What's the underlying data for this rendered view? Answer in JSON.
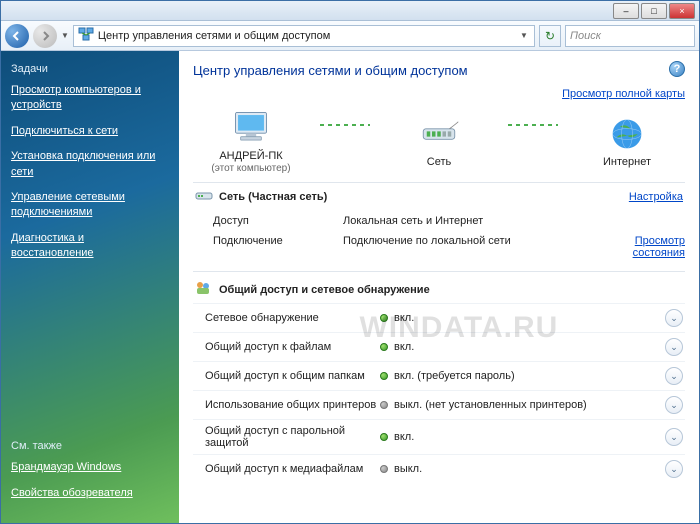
{
  "titlebar": {
    "min": "–",
    "max": "□",
    "close": "×"
  },
  "address_bar": {
    "text": "Центр управления сетями и общим доступом",
    "dropdown": "▼",
    "refresh": "↻"
  },
  "search": {
    "placeholder": "Поиск"
  },
  "sidebar": {
    "header": "Задачи",
    "links": [
      "Просмотр компьютеров и устройств",
      "Подключиться к сети",
      "Установка подключения или сети",
      "Управление сетевыми подключениями",
      "Диагностика и восстановление"
    ],
    "footer_header": "См. также",
    "footer_links": [
      "Брандмауэр Windows",
      "Свойства обозревателя"
    ]
  },
  "content": {
    "help": "?",
    "title": "Центр управления сетями и общим доступом",
    "map_link": "Просмотр полной карты",
    "diagram": {
      "pc": {
        "label": "АНДРЕЙ-ПК",
        "sub": "(этот компьютер)"
      },
      "net": {
        "label": "Сеть"
      },
      "inet": {
        "label": "Интернет"
      }
    },
    "network_section": {
      "title": "Сеть (Частная сеть)",
      "customize": "Настройка",
      "rows": [
        {
          "k": "Доступ",
          "v": "Локальная сеть и Интернет",
          "act": ""
        },
        {
          "k": "Подключение",
          "v": "Подключение по локальной сети",
          "act": "Просмотр состояния"
        }
      ]
    },
    "sharing_section": {
      "title": "Общий доступ и сетевое обнаружение",
      "options": [
        {
          "name": "Сетевое обнаружение",
          "on": true,
          "status": "вкл."
        },
        {
          "name": "Общий доступ к файлам",
          "on": true,
          "status": "вкл."
        },
        {
          "name": "Общий доступ к общим папкам",
          "on": true,
          "status": "вкл. (требуется пароль)"
        },
        {
          "name": "Использование общих принтеров",
          "on": false,
          "status": "выкл. (нет установленных принтеров)"
        },
        {
          "name": "Общий доступ с парольной защитой",
          "on": true,
          "status": "вкл."
        },
        {
          "name": "Общий доступ к медиафайлам",
          "on": false,
          "status": "выкл."
        }
      ]
    }
  },
  "watermark": "WINDATA.RU"
}
